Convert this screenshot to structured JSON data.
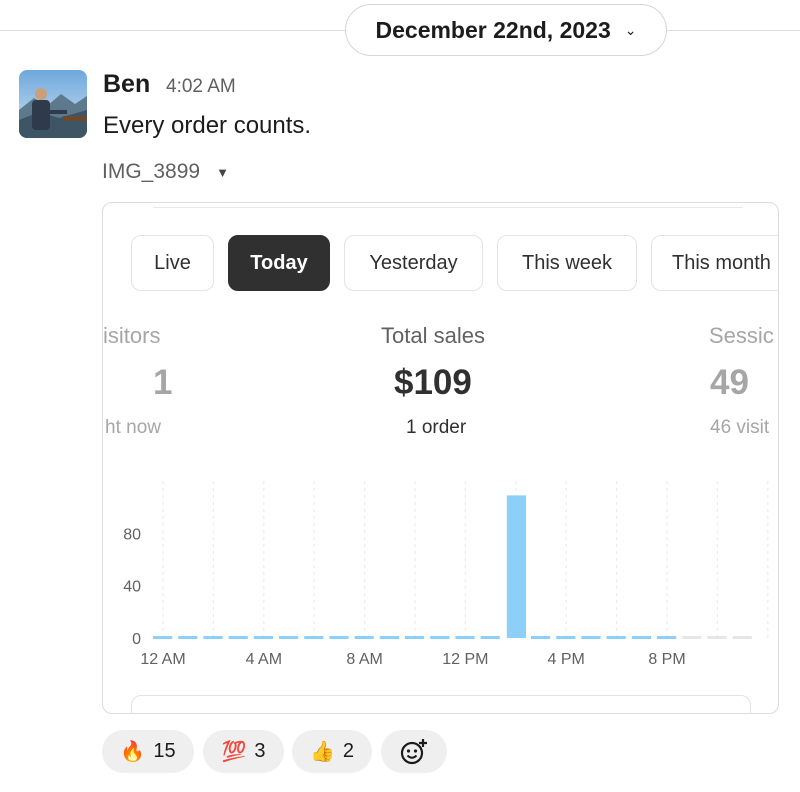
{
  "day_divider": {
    "label": "December 22nd, 2023"
  },
  "message": {
    "author": "Ben",
    "time": "4:02 AM",
    "text": "Every order counts.",
    "attachment_name": "IMG_3899"
  },
  "dashboard": {
    "tabs": [
      {
        "label": "Live",
        "active": false
      },
      {
        "label": "Today",
        "active": true
      },
      {
        "label": "Yesterday",
        "active": false
      },
      {
        "label": "This week",
        "active": false
      },
      {
        "label": "This month",
        "active": false
      }
    ],
    "metrics": [
      {
        "label": "isitors",
        "value": "1",
        "sub": "ht now"
      },
      {
        "label": "Total sales",
        "value": "$109",
        "sub": "1 order"
      },
      {
        "label": "Sessic",
        "value": "49",
        "sub": "46 visit"
      }
    ]
  },
  "chart_data": {
    "type": "bar",
    "categories": [
      "12 AM",
      "1 AM",
      "2 AM",
      "3 AM",
      "4 AM",
      "5 AM",
      "6 AM",
      "7 AM",
      "8 AM",
      "9 AM",
      "10 AM",
      "11 AM",
      "12 PM",
      "1 PM",
      "2 PM",
      "3 PM",
      "4 PM",
      "5 PM",
      "6 PM",
      "7 PM",
      "8 PM",
      "9 PM",
      "10 PM",
      "11 PM"
    ],
    "values": [
      0,
      0,
      0,
      0,
      0,
      0,
      0,
      0,
      0,
      0,
      0,
      0,
      0,
      0,
      109,
      0,
      0,
      0,
      0,
      0,
      0,
      0,
      0,
      0
    ],
    "x_tick_labels": [
      "12 AM",
      "4 AM",
      "8 AM",
      "12 PM",
      "4 PM",
      "8 PM"
    ],
    "y_ticks": [
      0,
      40,
      80
    ],
    "ylim": [
      0,
      120
    ],
    "grid": "vertical dashed",
    "bar_color": "#8ccff7",
    "future_color": "#e6e6e6",
    "elapsed_hours": 21
  },
  "reactions": [
    {
      "emoji": "🔥",
      "icon": "fire-icon",
      "count": "15"
    },
    {
      "emoji": "💯",
      "icon": "hundred-points-icon",
      "count": "3"
    },
    {
      "emoji": "👍",
      "icon": "thumbs-up-icon",
      "count": "2"
    }
  ],
  "colors": {
    "active_tab": "#303030",
    "bar": "#8ccff7",
    "reaction_bg": "#efefef"
  }
}
